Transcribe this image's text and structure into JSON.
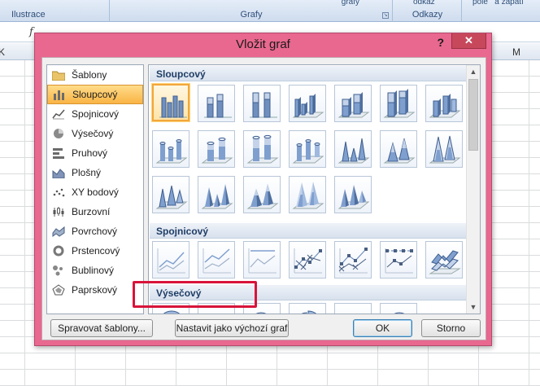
{
  "ribbon": {
    "groups": [
      {
        "label": "Ilustrace"
      },
      {
        "label": "Grafy",
        "top": "grafy"
      },
      {
        "label": "Odkazy",
        "top": "odkaz"
      },
      {
        "label": "",
        "top": "pole   a zápatí"
      }
    ]
  },
  "formula_bar": {
    "fx_label": "f"
  },
  "columns": {
    "left": "K",
    "right": "M"
  },
  "dialog": {
    "title": "Vložit graf",
    "help": "?",
    "close": "✕",
    "chart_types": [
      {
        "label": "Šablony",
        "icon": "folder-icon"
      },
      {
        "label": "Sloupcový",
        "icon": "column-chart-icon"
      },
      {
        "label": "Spojnicový",
        "icon": "line-chart-icon"
      },
      {
        "label": "Výsečový",
        "icon": "pie-chart-icon"
      },
      {
        "label": "Pruhový",
        "icon": "bar-chart-icon"
      },
      {
        "label": "Plošný",
        "icon": "area-chart-icon"
      },
      {
        "label": "XY bodový",
        "icon": "scatter-chart-icon"
      },
      {
        "label": "Burzovní",
        "icon": "stock-chart-icon"
      },
      {
        "label": "Povrchový",
        "icon": "surface-chart-icon"
      },
      {
        "label": "Prstencový",
        "icon": "doughnut-chart-icon"
      },
      {
        "label": "Bublinový",
        "icon": "bubble-chart-icon"
      },
      {
        "label": "Paprskový",
        "icon": "radar-chart-icon"
      }
    ],
    "selected_type": "Sloupcový",
    "sections": [
      {
        "label": "Sloupcový"
      },
      {
        "label": "Spojnicový"
      },
      {
        "label": "Výsečový"
      }
    ],
    "buttons": {
      "manage_templates": "Spravovat šablony...",
      "set_default": "Nastavit jako výchozí graf",
      "ok": "OK",
      "cancel": "Storno"
    }
  },
  "colors": {
    "dialog_frame": "#e8688f",
    "close_button": "#c7485b",
    "selection": "#f9b445",
    "highlight_box": "#d8143a",
    "chart_blue": "#4f81bd"
  }
}
